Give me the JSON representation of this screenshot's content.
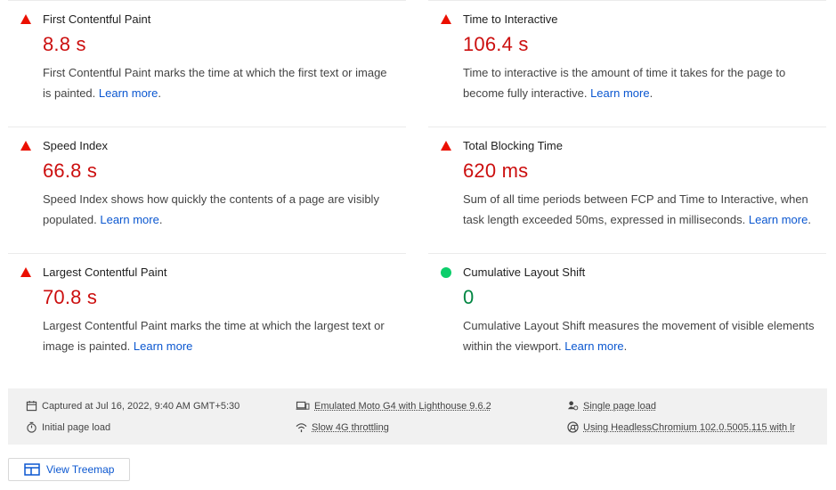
{
  "metrics": [
    {
      "title": "First Contentful Paint",
      "value": "8.8 s",
      "status": "fail",
      "desc": "First Contentful Paint marks the time at which the first text or image is painted.",
      "link": "Learn more"
    },
    {
      "title": "Time to Interactive",
      "value": "106.4 s",
      "status": "fail",
      "desc": "Time to interactive is the amount of time it takes for the page to become fully interactive.",
      "link": "Learn more"
    },
    {
      "title": "Speed Index",
      "value": "66.8 s",
      "status": "fail",
      "desc": "Speed Index shows how quickly the contents of a page are visibly populated.",
      "link": "Learn more"
    },
    {
      "title": "Total Blocking Time",
      "value": "620 ms",
      "status": "fail",
      "desc": "Sum of all time periods between FCP and Time to Interactive, when task length exceeded 50ms, expressed in milliseconds.",
      "link": "Learn more"
    },
    {
      "title": "Largest Contentful Paint",
      "value": "70.8 s",
      "status": "fail",
      "desc": "Largest Contentful Paint marks the time at which the largest text or image is painted.",
      "link": "Learn more"
    },
    {
      "title": "Cumulative Layout Shift",
      "value": "0",
      "status": "pass",
      "desc": "Cumulative Layout Shift measures the movement of visible elements within the viewport.",
      "link": "Learn more"
    }
  ],
  "footer": {
    "captured": "Captured at Jul 16, 2022, 9:40 AM GMT+5:30",
    "initial": "Initial page load",
    "emulated": "Emulated Moto G4 with Lighthouse 9.6.2",
    "throttling": "Slow 4G throttling",
    "single": "Single page load",
    "using": "Using HeadlessChromium 102.0.5005.115 with lr"
  },
  "treemap_label": "View Treemap",
  "colors": {
    "fail": "#cc0f0f",
    "pass": "#018642",
    "link": "#0b57d0",
    "fail_icon": "#eb0f00",
    "pass_icon": "#0cce6b"
  },
  "icons": {
    "fail": "red-triangle-icon",
    "pass": "green-circle-icon"
  }
}
